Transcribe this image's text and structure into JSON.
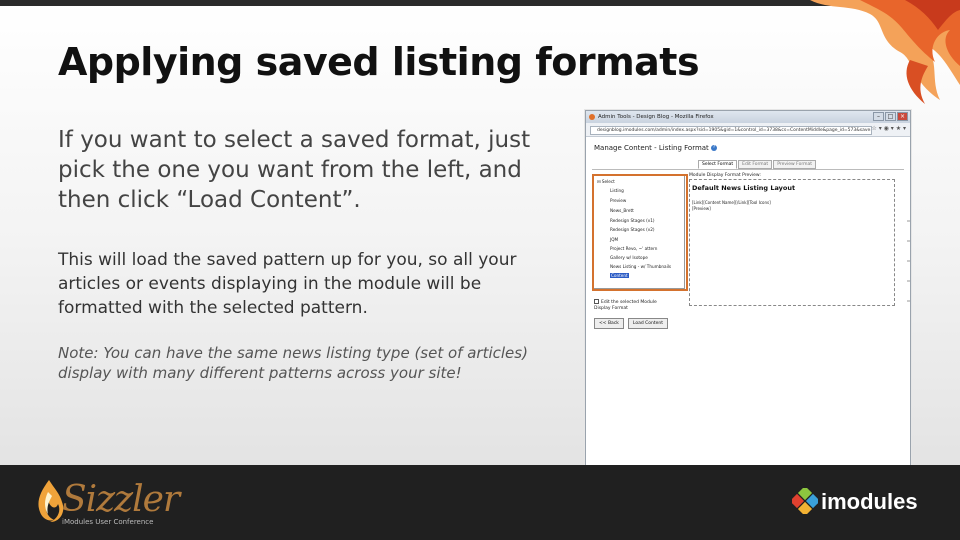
{
  "slide": {
    "title": "Applying saved listing formats",
    "paragraph1": "If you want to select a saved format, just pick the one you want from the left, and then click “Load Content”.",
    "paragraph2": "This will load the saved pattern up for you, so all your articles or events displaying in the module will be formatted with the selected pattern.",
    "note": "Note: You can have the same news listing type (set of articles) display with many different patterns across your site!"
  },
  "screenshot": {
    "window_title": "Admin Tools - Design Blog - Mozilla Firefox",
    "url": "designblog.imodules.com/admin/index.aspx?sid=1905&gid=1&control_id=3738&cs=ContentMiddle&page_id=573&save=",
    "page_title": "Manage Content - Listing Format",
    "tabs": [
      "Select Format",
      "Edit Format",
      "Preview Format"
    ],
    "preview_label": "Module Display Format Preview:",
    "list_root": "Select",
    "list_items": [
      "Listing",
      "Preview",
      "News_Brett",
      "Redesign Stages (v1)",
      "Redesign Stages (v2)",
      "JQM",
      "Project Revo, ~' attern",
      "Gallery w/ Isotope",
      "News Listing - w/ Thumbnails",
      "Content"
    ],
    "preview_heading": "Default News Listing Layout",
    "preview_line1": "[Link][Content Name][/Link][Tool Icons]",
    "preview_line2": "[Preview]",
    "checkbox_label": "Edit the selected Module Display Format",
    "back_button": "<< Back",
    "load_button": "Load Content"
  },
  "footer": {
    "brand": "Sizzler",
    "subtitle": "iModules User Conference",
    "partner": "imodules"
  },
  "colors": {
    "highlight": "#d4722e",
    "footer_bg": "#202020",
    "selection": "#2c5cc5"
  }
}
